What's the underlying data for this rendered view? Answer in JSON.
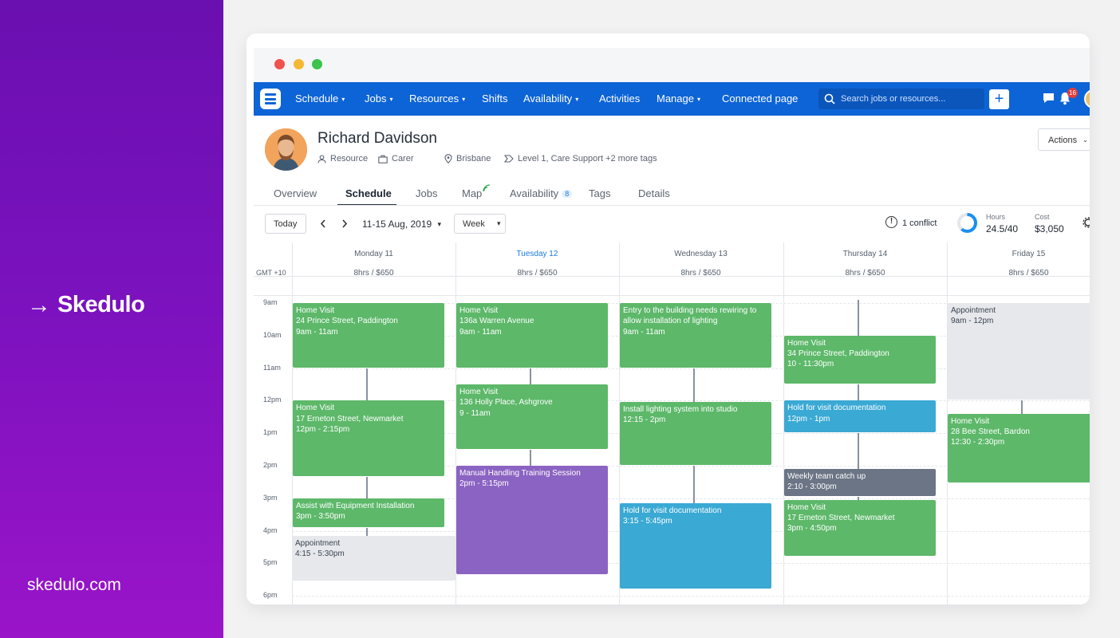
{
  "brand": {
    "arrow": "→",
    "name": "Skedulo",
    "url": "skedulo.com"
  },
  "nav": {
    "items": [
      {
        "label": "Schedule",
        "caret": true
      },
      {
        "label": "Jobs",
        "caret": true
      },
      {
        "label": "Resources",
        "caret": true
      },
      {
        "label": "Shifts",
        "caret": false
      },
      {
        "label": "Availability",
        "caret": true
      },
      {
        "label": "Activities",
        "caret": false
      },
      {
        "label": "Manage",
        "caret": true
      },
      {
        "label": "Connected page",
        "caret": false
      }
    ],
    "search_placeholder": "Search jobs or resources...",
    "plus": "+",
    "notifications": "16",
    "accent": "#0d64d6"
  },
  "profile": {
    "name": "Richard Davidson",
    "role": "Resource",
    "job_type": "Carer",
    "location": "Brisbane",
    "tags": "Level 1, Care Support +2 more tags",
    "actions": "Actions"
  },
  "tabs": [
    {
      "label": "Overview"
    },
    {
      "label": "Schedule",
      "active": true
    },
    {
      "label": "Jobs"
    },
    {
      "label": "Map"
    },
    {
      "label": "Availability",
      "badge": "8"
    },
    {
      "label": "Tags"
    },
    {
      "label": "Details"
    }
  ],
  "toolbar": {
    "today": "Today",
    "range": "11-15 Aug, 2019",
    "view": "Week",
    "conflict": "1 conflict",
    "hours_label": "Hours",
    "hours_value": "24.5/40",
    "hours_fraction": 0.6125,
    "cost_label": "Cost",
    "cost_value": "$3,050"
  },
  "calendar": {
    "timezone": "GMT +10",
    "hours": [
      "9am",
      "10am",
      "11am",
      "12pm",
      "1pm",
      "2pm",
      "3pm",
      "4pm",
      "5pm",
      "6pm"
    ],
    "days": [
      {
        "title": "Monday 11",
        "summary": "8hrs / $650",
        "events": [
          {
            "title": "Home Visit",
            "detail": "24 Prince Street, Paddington",
            "time": "9am - 11am",
            "color": "green",
            "start": 9,
            "end": 11
          },
          {
            "title": "Home Visit",
            "detail": "17 Erneton Street, Newmarket",
            "time": "12pm - 2:15pm",
            "color": "green",
            "start": 12,
            "end": 14.35
          },
          {
            "title": "Assist with Equipment Installation",
            "detail": "",
            "time": "3pm - 3:50pm",
            "color": "green",
            "start": 15,
            "end": 15.9
          },
          {
            "title": "Appointment",
            "detail": "",
            "time": "4:15 - 5:30pm",
            "color": "gray",
            "start": 16.15,
            "end": 17.55
          }
        ]
      },
      {
        "title": "Tuesday 12",
        "summary": "8hrs / $650",
        "today": true,
        "events": [
          {
            "title": "Home Visit",
            "detail": "136a Warren Avenue",
            "time": "9am - 11am",
            "color": "green",
            "start": 9,
            "end": 11
          },
          {
            "title": "Home Visit",
            "detail": "136 Holly Place, Ashgrove",
            "time": "9 - 11am",
            "color": "green",
            "start": 11.5,
            "end": 13.5
          },
          {
            "title": "Manual Handling Training Session",
            "detail": "",
            "time": "2pm - 5:15pm",
            "color": "purple",
            "start": 14,
            "end": 17.35
          }
        ]
      },
      {
        "title": "Wednesday 13",
        "summary": "8hrs / $650",
        "events": [
          {
            "title": "Entry to the building needs rewiring to allow installation of lighting",
            "detail": "",
            "time": "9am - 11am",
            "color": "green",
            "start": 9,
            "end": 11
          },
          {
            "title": "Install lighting system into studio",
            "detail": "",
            "time": "12:15 - 2pm",
            "color": "green",
            "start": 12.03,
            "end": 14
          },
          {
            "title": "Hold for visit documentation",
            "detail": "",
            "time": "3:15 - 5:45pm",
            "color": "blue",
            "start": 15.15,
            "end": 17.8
          }
        ]
      },
      {
        "title": "Thursday 14",
        "summary": "8hrs / $650",
        "events": [
          {
            "title": "Home Visit",
            "detail": "34 Prince Street, Paddington",
            "time": "10 - 11:30pm",
            "color": "green",
            "start": 10,
            "end": 11.5
          },
          {
            "title": "Hold for visit documentation",
            "detail": "",
            "time": "12pm - 1pm",
            "color": "blue",
            "start": 12,
            "end": 13
          },
          {
            "title": "Weekly team catch up",
            "detail": "",
            "time": "2:10 - 3:00pm",
            "color": "slate",
            "start": 14.1,
            "end": 14.95
          },
          {
            "title": "Home Visit",
            "detail": "17 Erneton Street, Newmarket",
            "time": "3pm - 4:50pm",
            "color": "green",
            "start": 15.05,
            "end": 16.8
          }
        ]
      },
      {
        "title": "Friday 15",
        "summary": "8hrs / $650",
        "events": [
          {
            "title": "Appointment",
            "detail": "",
            "time": "9am - 12pm",
            "color": "gray",
            "start": 9,
            "end": 12
          },
          {
            "title": "Home Visit",
            "detail": "28 Bee Street, Bardon",
            "time": "12:30 - 2:30pm",
            "color": "green",
            "start": 12.4,
            "end": 14.55
          }
        ]
      }
    ]
  }
}
